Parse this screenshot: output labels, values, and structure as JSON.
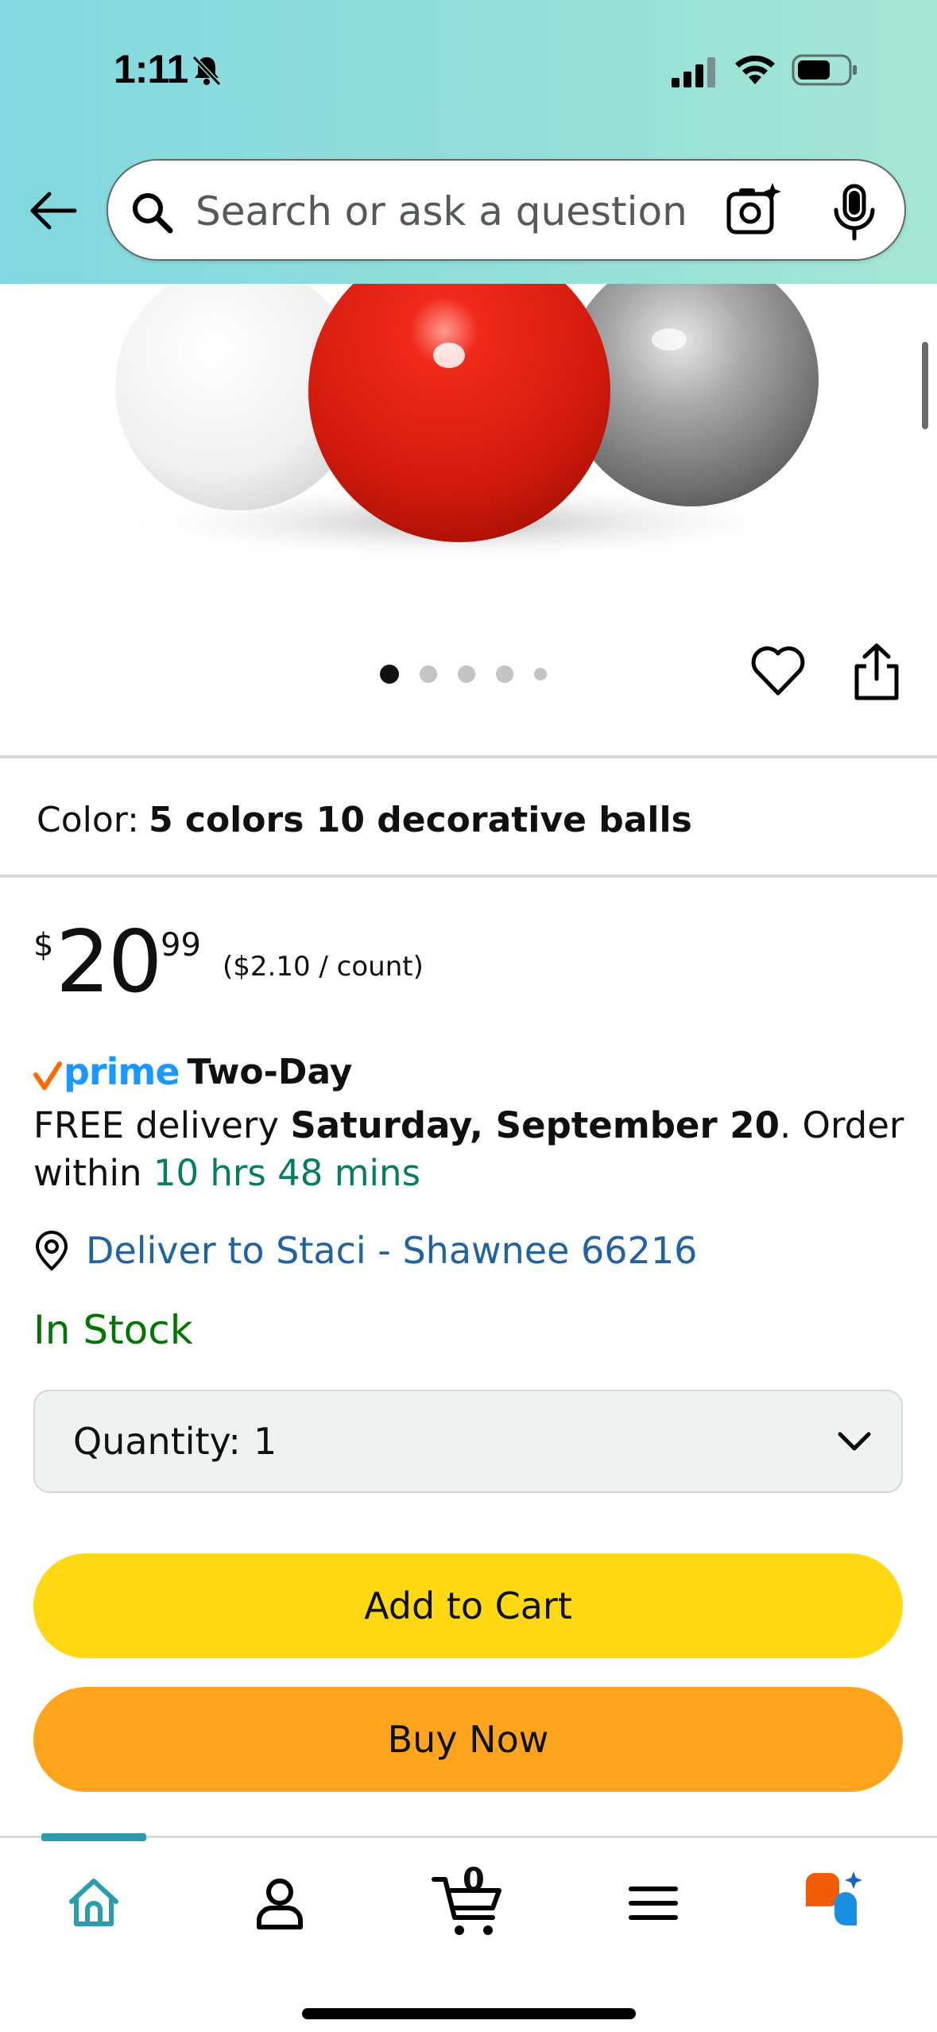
{
  "status_bar": {
    "time": "1:11"
  },
  "search": {
    "placeholder": "Search or ask a question"
  },
  "image_carousel": {
    "pages": 5,
    "active_index": 0
  },
  "variation": {
    "label": "Color:",
    "value": "5 colors 10 decorative balls"
  },
  "price": {
    "symbol": "$",
    "whole": "20",
    "fraction": "99",
    "unit_price": "($2.10 / count)"
  },
  "delivery": {
    "prime_label": "prime",
    "speed": "Two-Day",
    "free_text": "FREE delivery",
    "date": "Saturday, September 20",
    "order_within_prefix": ". Order within",
    "countdown": "10 hrs 48 mins",
    "deliver_to": "Deliver to Staci - Shawnee 66216"
  },
  "stock_status": "In Stock",
  "quantity": {
    "label": "Quantity:",
    "value": "1"
  },
  "buttons": {
    "add_to_cart": "Add to Cart",
    "buy_now": "Buy Now"
  },
  "bottom_nav": {
    "cart_count": "0",
    "items": [
      "home",
      "account",
      "cart",
      "menu",
      "rufus"
    ]
  },
  "colors": {
    "add_to_cart": "#ffd814",
    "buy_now": "#ffa41c",
    "link": "#2162a1",
    "in_stock": "#007600",
    "countdown": "#067d62",
    "prime": "#1a98ff",
    "nav_active": "#2a9dad"
  }
}
